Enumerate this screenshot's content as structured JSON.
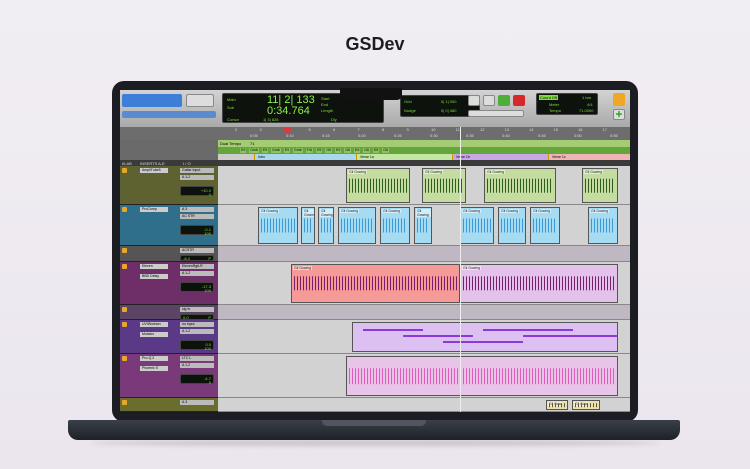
{
  "page": {
    "title": "GSDev"
  },
  "counter": {
    "main_label": "Main",
    "sub_label": "Sub",
    "main": "11| 2| 133",
    "sub": "0:34.764",
    "start_label": "Start",
    "end_label": "End",
    "length_label": "Length",
    "cursor_label": "Cursor",
    "cursor": "1| 3| 828",
    "dly_label": "Dly",
    "nudge_label": "Nudge",
    "grid_label": "Grid",
    "grid_value": "0| 1| 000",
    "nudge_value": "0| 0| 480",
    "countoff": "Count Off",
    "meter_label": "Meter",
    "tempo_label": "Tempo",
    "bar": "1 bar",
    "meter": "4/4",
    "tempo": "71.0000"
  },
  "ruler": {
    "bars": [
      "2",
      "3",
      "4",
      "5",
      "6",
      "7",
      "8",
      "9",
      "10",
      "11",
      "12",
      "13",
      "14",
      "15",
      "16",
      "17"
    ],
    "times": [
      "0:05",
      "0:10",
      "0:15",
      "0:20",
      "0:25",
      "0:30",
      "0:35",
      "0:40",
      "0:45",
      "0:50",
      "0:55"
    ],
    "tempo_label": "Dual Tempo",
    "tempo_value": "71"
  },
  "chords": [
    "E9",
    "Gm6",
    "E9",
    "Gm6",
    "E9",
    "Gm6",
    "F/A",
    "E9",
    "G6",
    "E9",
    "G6",
    "E9",
    "G6",
    "E9",
    "G6"
  ],
  "markers": [
    {
      "label": "Intro",
      "color": "#a9d8ee"
    },
    {
      "label": "Verse 1a",
      "color": "#c3e6a5"
    },
    {
      "label": "Verse 1b",
      "color": "#c9a6e6"
    },
    {
      "label": "Verse 1c",
      "color": "#f0b4b4"
    }
  ],
  "header": {
    "col1": "I/LAB",
    "col2": "INSERTS A-E",
    "col3": "I / O"
  },
  "tracks": [
    {
      "insert": "AmpliTube5",
      "input": "Guitar Input",
      "out": "A 1-2",
      "vol": "+10.0",
      "pan": "0",
      "color": "#5e6230",
      "clip_color": "#c4dca0",
      "clip_name": "Gil Gowing"
    },
    {
      "insert": "ProComp",
      "input": "A 3",
      "out": "AC STR",
      "vol": "-0.1",
      "pan": "100",
      "color": "#2f6f8c",
      "clip_color": "#a7dbf2",
      "clip_name": "Gil Gowing"
    },
    {
      "insert": "",
      "input": "ACSTR",
      "out": "A 1-2",
      "vol": "-8.4",
      "pan": "P",
      "color": "#555",
      "clip_color": "",
      "clip_name": ""
    },
    {
      "insert": "Eleven",
      "input": "ElevenRgtLR",
      "out": "A 1-2",
      "insert2": "BBD Delay",
      "vol": "-17.3",
      "pan": "100",
      "color": "#6e2f68",
      "clip_color": "#f59a96",
      "clip_name": "Gil Gowing"
    },
    {
      "insert": "",
      "input": "sig fx",
      "out": "A 1-2",
      "vol": "0.0",
      "pan": "P",
      "color": "#5b4466",
      "clip_color": "",
      "clip_name": ""
    },
    {
      "insert": "UVIWorkstn",
      "input": "no input",
      "out": "A 1-2",
      "insert2": "Mutator",
      "vol": "0.0",
      "pan": "100",
      "color": "#5a3a86",
      "clip_color": "#dcc0f2",
      "clip_name": ""
    },
    {
      "insert": "Pro-Q 2",
      "input": "LTC L",
      "out": "A 1-2",
      "insert2": "Phoenix S",
      "vol": "-4.7",
      "pan": "0",
      "color": "#7a3a7a",
      "clip_color": "#e8c4e8",
      "clip_name": ""
    },
    {
      "insert": "",
      "input": "A 3",
      "out": "A 1-2",
      "vol": "",
      "pan": "",
      "color": "#6a6d2e",
      "clip_color": "#eee2a8",
      "clip_name": "Gil Gow"
    }
  ]
}
